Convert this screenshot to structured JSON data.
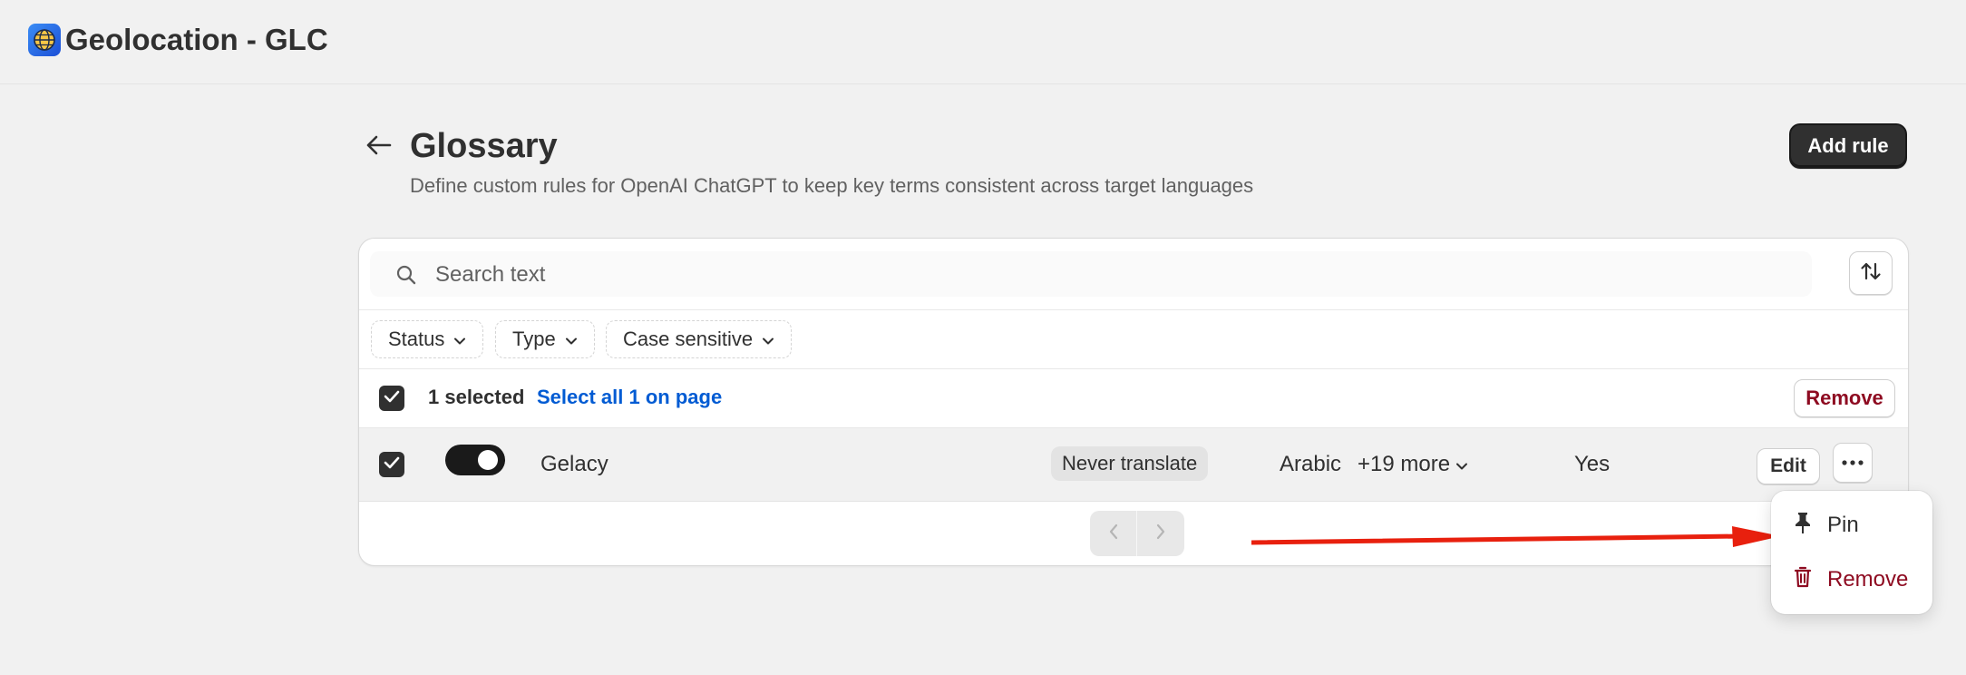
{
  "app": {
    "title": "Geolocation - GLC",
    "icon": "globe-icon"
  },
  "page": {
    "title": "Glossary",
    "subtitle": "Define custom rules for OpenAI ChatGPT to keep key terms consistent across target languages",
    "add_rule_label": "Add rule"
  },
  "search": {
    "placeholder": "Search text",
    "value": ""
  },
  "filters": [
    {
      "label": "Status"
    },
    {
      "label": "Type"
    },
    {
      "label": "Case sensitive"
    }
  ],
  "bulk": {
    "selected_label": "1 selected",
    "select_all_label": "Select all 1 on page",
    "remove_label": "Remove"
  },
  "rows": [
    {
      "checked": true,
      "enabled": true,
      "term": "Gelacy",
      "type": "Never translate",
      "language": "Arabic",
      "more_languages": "+19 more",
      "case_sensitive": "Yes",
      "edit_label": "Edit"
    }
  ],
  "menu": {
    "items": [
      {
        "label": "Pin",
        "icon": "pin-icon"
      },
      {
        "label": "Remove",
        "icon": "trash-icon"
      }
    ]
  },
  "colors": {
    "background": "#f1f1f1",
    "primary_button": "#303030",
    "link": "#005bd3",
    "critical": "#8e0b21",
    "annotation_arrow": "#e8200e"
  }
}
